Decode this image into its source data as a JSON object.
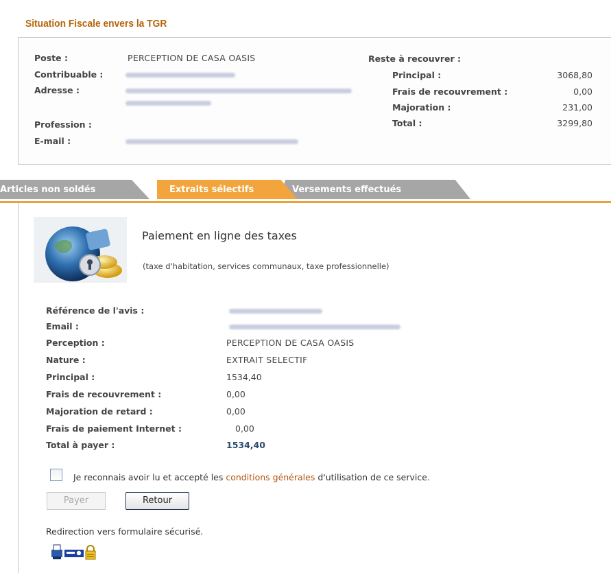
{
  "header": {
    "title": "Situation Fiscale envers la TGR"
  },
  "summary": {
    "poste_label": "Poste :",
    "poste_value": "PERCEPTION DE CASA OASIS",
    "contribuable_label": "Contribuable :",
    "adresse_label": "Adresse :",
    "profession_label": "Profession :",
    "email_label": "E-mail :",
    "reste_label": "Reste à recouvrer :",
    "principal_label": "Principal :",
    "principal_value": "3068,80",
    "frais_label": "Frais de recouvrement :",
    "frais_value": "0,00",
    "majoration_label": "Majoration :",
    "majoration_value": "231,00",
    "total_label": "Total :",
    "total_value": "3299,80"
  },
  "tabs": [
    {
      "label": "Articles non soldés",
      "active": false
    },
    {
      "label": "Extraits sélectifs",
      "active": true
    },
    {
      "label": "Versements effectués",
      "active": false
    }
  ],
  "payment": {
    "title": "Paiement en ligne des taxes",
    "subtitle": "(taxe d'habitation, services communaux, taxe professionnelle)",
    "reference_label": "Référence de l'avis :",
    "email_label": "Email :",
    "perception_label": "Perception :",
    "perception_value": "PERCEPTION DE CASA OASIS",
    "nature_label": "Nature :",
    "nature_value": "EXTRAIT SELECTIF",
    "principal_label": "Principal :",
    "principal_value": "1534,40",
    "frais_label": "Frais de recouvrement :",
    "frais_value": "0,00",
    "majoration_label": "Majoration de retard :",
    "majoration_value": "0,00",
    "internet_label": "Frais de paiement Internet :",
    "internet_value": "0,00",
    "total_label": "Total à payer :",
    "total_value": "1534,40",
    "terms_prefix": "Je reconnais avoir lu et accepté les ",
    "terms_link": "conditions générales",
    "terms_suffix": " d'utilisation de ce service.",
    "pay_button": "Payer",
    "back_button": "Retour",
    "redirect_text": "Redirection vers formulaire sécurisé."
  },
  "colors": {
    "title": "#b5650a",
    "active_tab": "#f2a53d",
    "inactive_tab": "#a6a6a6",
    "link": "#b4520e",
    "total_value": "#2d4b6e"
  },
  "icons": [
    "globe-coin-lock-icon",
    "printer-icon",
    "secure-key-icon",
    "padlock-icon"
  ]
}
